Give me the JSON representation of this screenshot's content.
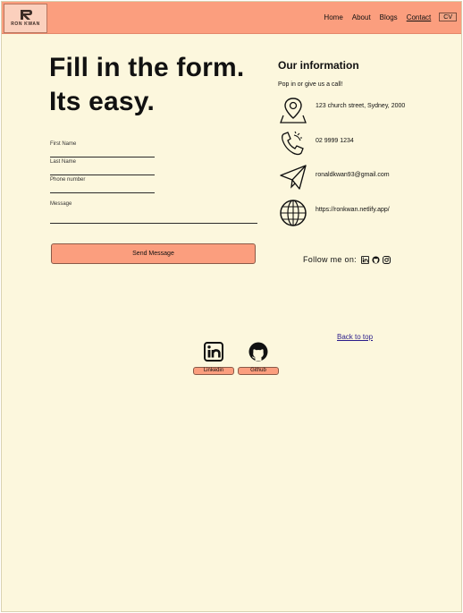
{
  "brand": {
    "logo_text": "RON KWAN"
  },
  "nav": {
    "items": [
      {
        "label": "Home"
      },
      {
        "label": "About"
      },
      {
        "label": "Blogs"
      },
      {
        "label": "Contact"
      }
    ],
    "cv_label": "CV"
  },
  "form": {
    "heading_line1": "Fill in the form.",
    "heading_line2": "Its easy.",
    "first_name_label": "First Name",
    "last_name_label": "Last Name",
    "phone_label": "Phone number",
    "message_label": "Message",
    "send_label": "Send Message"
  },
  "info": {
    "title": "Our information",
    "subtitle": "Pop in or give us a call!",
    "address": "123 church street, Sydney, 2000",
    "phone": "02 9999 1234",
    "email": "ronaldkwan93@gmail.com",
    "website": "https://ronkwan.netlify.app/",
    "follow_label": "Follow me on:"
  },
  "back_to_top": "Back to top",
  "footer": {
    "linkedin_label": "Linkedin",
    "github_label": "Github"
  },
  "colors": {
    "accent": "#fb9e7e",
    "background": "#fcf7dd"
  }
}
